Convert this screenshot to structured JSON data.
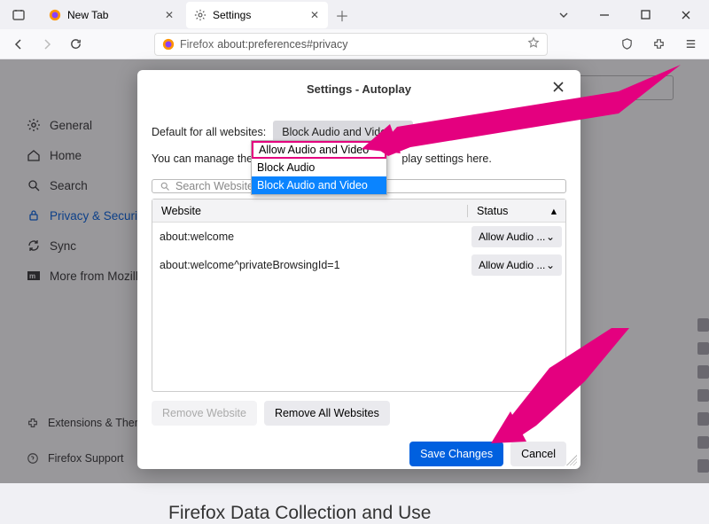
{
  "tabs": {
    "new_tab_label": "New Tab",
    "settings_label": "Settings"
  },
  "urlbar": {
    "identity": "Firefox",
    "url": "about:preferences#privacy"
  },
  "sidebar": {
    "items": {
      "general": "General",
      "home": "Home",
      "search": "Search",
      "privacy": "Privacy & Security",
      "sync": "Sync",
      "more": "More from Mozilla"
    },
    "bottom": {
      "ext": "Extensions & Themes",
      "support": "Firefox Support"
    }
  },
  "content": {
    "section_heading": "Firefox Data Collection and Use"
  },
  "dialog": {
    "title": "Settings - Autoplay",
    "default_label": "Default for all websites:",
    "default_select_value": "Block Audio and Video",
    "desc_prefix": "You can manage the site",
    "desc_suffix": "play settings here.",
    "dropdown": {
      "opt_allow": "Allow Audio and Video",
      "opt_block_audio": "Block Audio",
      "opt_block_av": "Block Audio and Video"
    },
    "search_placeholder": "Search Website",
    "table": {
      "head_website": "Website",
      "head_status": "Status",
      "rows": [
        {
          "website": "about:welcome",
          "status": "Allow Audio ..."
        },
        {
          "website": "about:welcome^privateBrowsingId=1",
          "status": "Allow Audio ..."
        }
      ]
    },
    "buttons": {
      "remove": "Remove Website",
      "remove_all": "Remove All Websites",
      "save": "Save Changes",
      "cancel": "Cancel"
    }
  }
}
